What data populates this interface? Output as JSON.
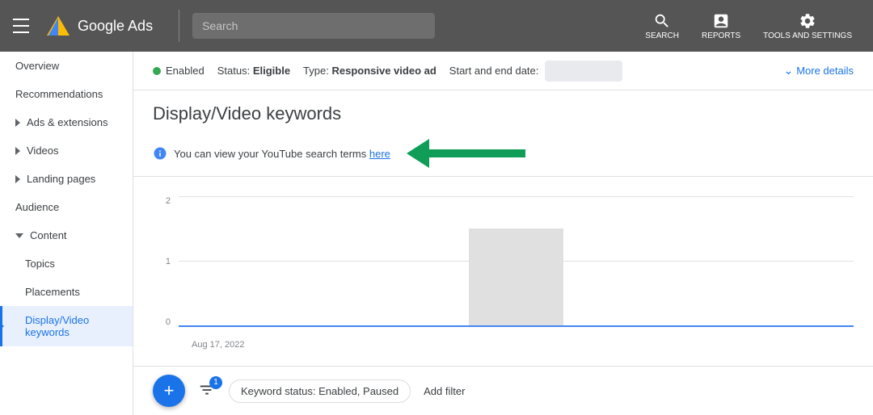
{
  "header": {
    "menu_aria": "Menu",
    "logo_text": "Google Ads",
    "search_label": "SEARCH",
    "reports_label": "REPORTS",
    "tools_label": "TOOLS AND SETTINGS"
  },
  "sidebar": {
    "items": [
      {
        "id": "overview",
        "label": "Overview",
        "type": "plain",
        "active": false
      },
      {
        "id": "recommendations",
        "label": "Recommendations",
        "type": "plain",
        "active": false
      },
      {
        "id": "ads-extensions",
        "label": "Ads & extensions",
        "type": "arrow",
        "active": false
      },
      {
        "id": "videos",
        "label": "Videos",
        "type": "arrow",
        "active": false
      },
      {
        "id": "landing-pages",
        "label": "Landing pages",
        "type": "arrow",
        "active": false
      },
      {
        "id": "audience",
        "label": "Audience",
        "type": "plain",
        "active": false
      },
      {
        "id": "content",
        "label": "Content",
        "type": "arrow-open",
        "active": false
      },
      {
        "id": "topics",
        "label": "Topics",
        "type": "indent",
        "active": false
      },
      {
        "id": "placements",
        "label": "Placements",
        "type": "indent",
        "active": false
      },
      {
        "id": "display-video-keywords",
        "label": "Display/Video keywords",
        "type": "indent",
        "active": true
      }
    ]
  },
  "status_bar": {
    "enabled_label": "Enabled",
    "status_prefix": "Status:",
    "status_value": "Eligible",
    "type_prefix": "Type:",
    "type_value": "Responsive video ad",
    "date_prefix": "Start and end date:",
    "more_details": "More details"
  },
  "page": {
    "title": "Display/Video keywords",
    "info_text": "You can view your YouTube search terms",
    "info_link": "here"
  },
  "chart": {
    "y_labels": [
      "2",
      "1",
      "0"
    ],
    "x_label": "Aug 17, 2022",
    "bar_x_percent": 43,
    "bar_width_percent": 14,
    "bar_height_percent": 75
  },
  "filter_bar": {
    "fab_label": "+",
    "filter_badge": "1",
    "filter_chip_label": "Keyword status: Enabled, Paused",
    "add_filter_label": "Add filter"
  }
}
